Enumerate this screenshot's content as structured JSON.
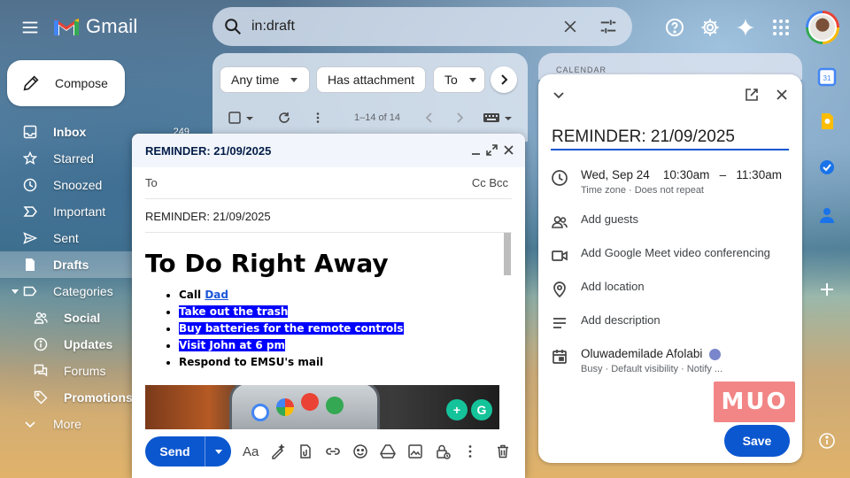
{
  "header": {
    "app_name": "Gmail",
    "search_value": "in:draft"
  },
  "sidebar": {
    "compose_label": "Compose",
    "items": [
      {
        "label": "Inbox",
        "count": "249",
        "icon": "inbox-icon"
      },
      {
        "label": "Starred",
        "icon": "star-icon"
      },
      {
        "label": "Snoozed",
        "icon": "clock-icon"
      },
      {
        "label": "Important",
        "icon": "label-important-icon"
      },
      {
        "label": "Sent",
        "icon": "send-icon"
      },
      {
        "label": "Drafts",
        "icon": "draft-icon"
      },
      {
        "label": "Categories",
        "icon": "label-icon"
      },
      {
        "label": "Social",
        "icon": "people-icon"
      },
      {
        "label": "Updates",
        "icon": "info-icon"
      },
      {
        "label": "Forums",
        "icon": "forum-icon"
      },
      {
        "label": "Promotions",
        "icon": "tag-icon"
      },
      {
        "label": "More",
        "icon": "chevron-down-icon"
      }
    ]
  },
  "mail_list": {
    "chips": [
      "Any time",
      "Has attachment",
      "To"
    ],
    "count_text": "1–14 of 14"
  },
  "composer": {
    "window_title": "REMINDER: 21/09/2025",
    "to_label": "To",
    "cc_bcc": "Cc Bcc",
    "subject": "REMINDER: 21/09/2025",
    "heading": "To Do Right Away",
    "items": [
      {
        "prefix": "Call ",
        "link": "Dad"
      },
      {
        "text": "Take out the trash"
      },
      {
        "text": "Buy batteries for the remote controls"
      },
      {
        "text": "Visit John at 6 pm"
      },
      {
        "text": "Respond to EMSU's mail"
      }
    ],
    "send_label": "Send",
    "format_label": "Aa"
  },
  "calendar": {
    "header_label": "CALENDAR",
    "event_title": "REMINDER: 21/09/2025",
    "date": "Wed, Sep 24",
    "start_time": "10:30am",
    "dash": "–",
    "end_time": "11:30am",
    "time_meta": "Time zone · Does not repeat",
    "add_guests": "Add guests",
    "add_meet": "Add Google Meet video conferencing",
    "add_location": "Add location",
    "add_description": "Add description",
    "owner": "Oluwademilade Afolabi",
    "owner_meta": "Busy · Default visibility · Notify ...",
    "save_label": "Save"
  },
  "watermark": "MUO",
  "colors": {
    "accent": "#0b57d0",
    "highlight": "#0000ff",
    "calendar_dot": "#7986cb"
  }
}
